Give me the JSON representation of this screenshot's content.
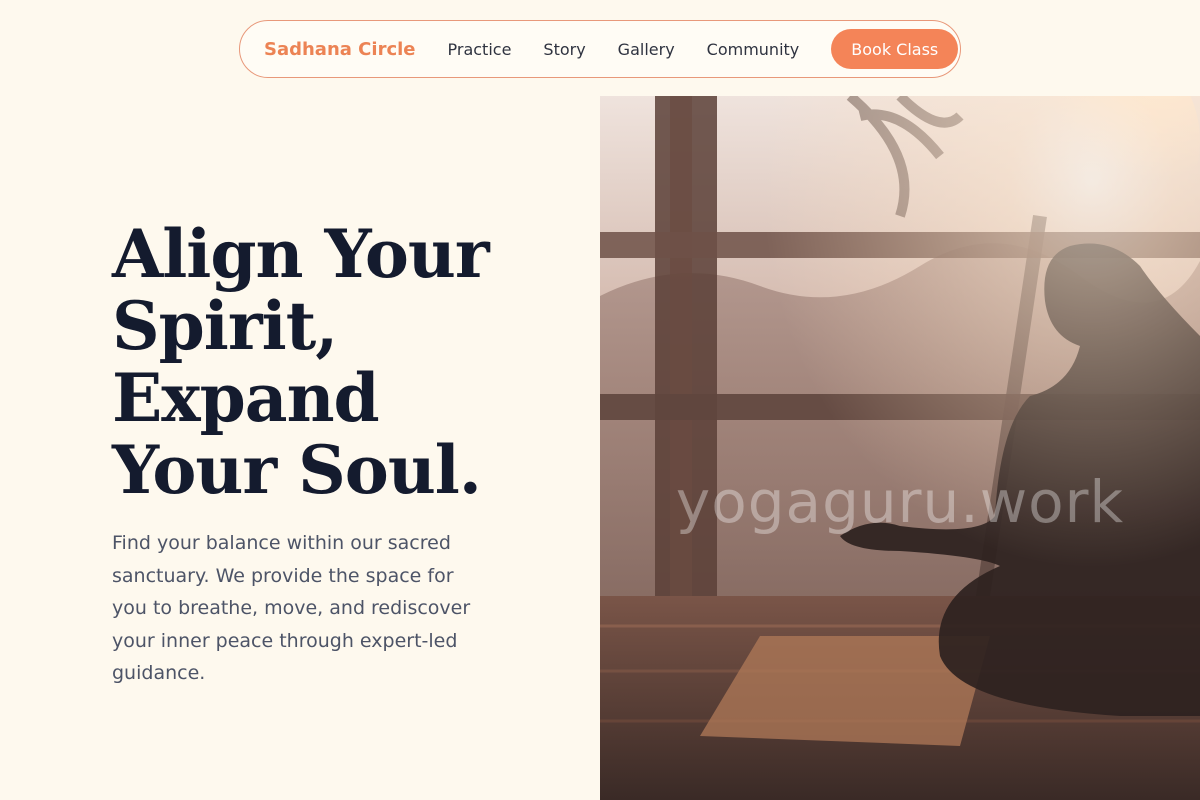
{
  "nav": {
    "brand": "Sadhana Circle",
    "links": [
      "Practice",
      "Story",
      "Gallery",
      "Community"
    ],
    "cta": "Book Class"
  },
  "hero": {
    "headline_lines": [
      "Align Your",
      "Spirit,",
      "Expand",
      "Your Soul."
    ],
    "description": "Find your balance within our sacred sanctuary. We provide the space for you to breathe, move, and rediscover your inner peace through expert-led guidance.",
    "image_watermark": "yogaguru.work"
  },
  "colors": {
    "background": "#fef9ee",
    "accent": "#f48458",
    "brand": "#ec8354",
    "heading": "#141b2e",
    "body_text": "#4d5467"
  }
}
